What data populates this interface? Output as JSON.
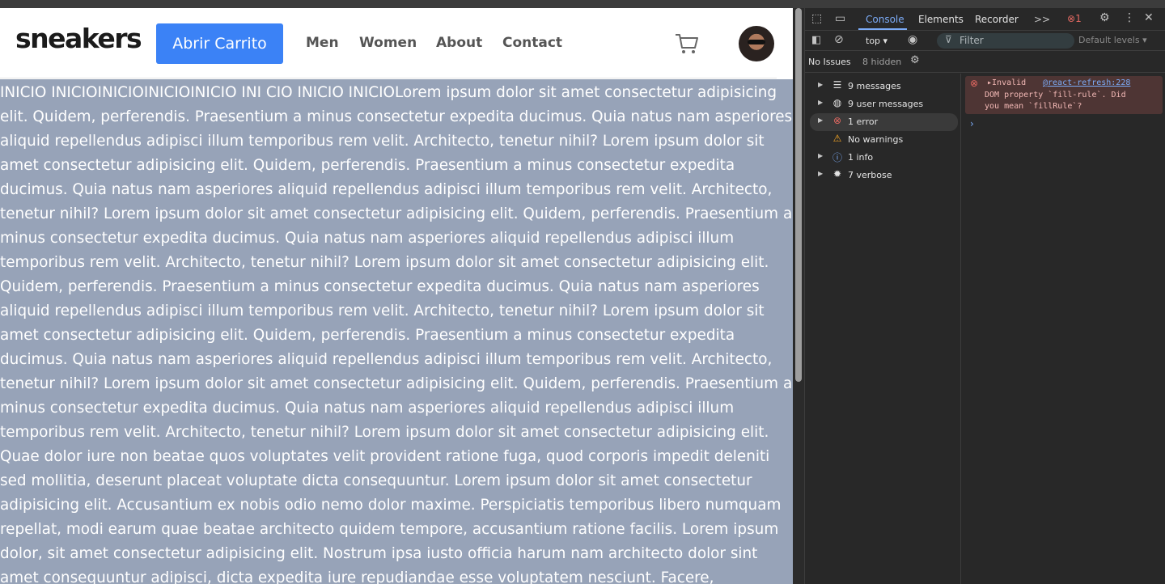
{
  "page": {
    "logo": "sneakers",
    "cart_button": "Abrir Carrito",
    "nav": [
      "Men",
      "Women",
      "About",
      "Contact"
    ],
    "cart_icon": "shopping-cart-icon",
    "avatar_icon": "user-avatar",
    "body_text": "INICIO INICIOINICIOINICIOINICIO INI CIO INICIO INICIOLorem ipsum dolor sit amet consectetur adipisicing elit. Quidem, perferendis. Praesentium a minus consectetur expedita ducimus. Quia natus nam asperiores aliquid repellendus adipisci illum temporibus rem velit. Architecto, tenetur nihil? Lorem ipsum dolor sit amet consectetur adipisicing elit. Quidem, perferendis. Praesentium a minus consectetur expedita ducimus. Quia natus nam asperiores aliquid repellendus adipisci illum temporibus rem velit. Architecto, tenetur nihil? Lorem ipsum dolor sit amet consectetur adipisicing elit. Quidem, perferendis. Praesentium a minus consectetur expedita ducimus. Quia natus nam asperiores aliquid repellendus adipisci illum temporibus rem velit. Architecto, tenetur nihil? Lorem ipsum dolor sit amet consectetur adipisicing elit. Quidem, perferendis. Praesentium a minus consectetur expedita ducimus. Quia natus nam asperiores aliquid repellendus adipisci illum temporibus rem velit. Architecto, tenetur nihil? Lorem ipsum dolor sit amet consectetur adipisicing elit. Quidem, perferendis. Praesentium a minus consectetur expedita ducimus. Quia natus nam asperiores aliquid repellendus adipisci illum temporibus rem velit. Architecto, tenetur nihil? Lorem ipsum dolor sit amet consectetur adipisicing elit. Quidem, perferendis. Praesentium a minus consectetur expedita ducimus. Quia natus nam asperiores aliquid repellendus adipisci illum temporibus rem velit. Architecto, tenetur nihil? Lorem ipsum dolor sit amet consectetur adipisicing elit. Quae dolor iure non beatae quos voluptates velit provident ratione fuga, quod corporis impedit deleniti sed mollitia, deserunt placeat voluptate dicta consequuntur. Lorem ipsum dolor sit amet consectetur adipisicing elit. Accusantium ex nobis odio nemo dolor maxime. Perspiciatis temporibus libero numquam repellat, modi earum quae beatae architecto quidem tempore, accusantium ratione facilis. Lorem ipsum dolor, sit amet consectetur adipisicing elit. Nostrum ipsa iusto officia harum nam architecto dolor sint amet consequuntur adipisci, dicta expedita iure repudiandae esse voluptatem nesciunt. Facere,"
  },
  "devtools": {
    "tabs": [
      "Console",
      "Elements",
      "Recorder"
    ],
    "more_tabs": ">>",
    "error_count": "1",
    "context": "top ▾",
    "filter_placeholder": "Filter",
    "levels": "Default levels ▾",
    "issues": "No Issues",
    "hidden": "8 hidden",
    "sidebar": [
      {
        "label": "9 messages",
        "icon": "list-icon"
      },
      {
        "label": "9 user messages",
        "icon": "user-icon"
      },
      {
        "label": "1 error",
        "icon": "error-icon"
      },
      {
        "label": "No warnings",
        "icon": "warning-icon"
      },
      {
        "label": "1 info",
        "icon": "info-icon"
      },
      {
        "label": "7 verbose",
        "icon": "bug-icon"
      }
    ],
    "message": {
      "line1": "Invalid",
      "source": "@react-refresh:228",
      "line2": "DOM property `fill-rule`. Did",
      "line3": "you mean `fillRule`?"
    },
    "prompt": "›"
  },
  "colors": {
    "accent": "#3b82f6",
    "content_bg": "#97a3b8",
    "devtools_bg": "#282828",
    "console_blue": "#7cacf8",
    "error_red": "#e46962"
  }
}
